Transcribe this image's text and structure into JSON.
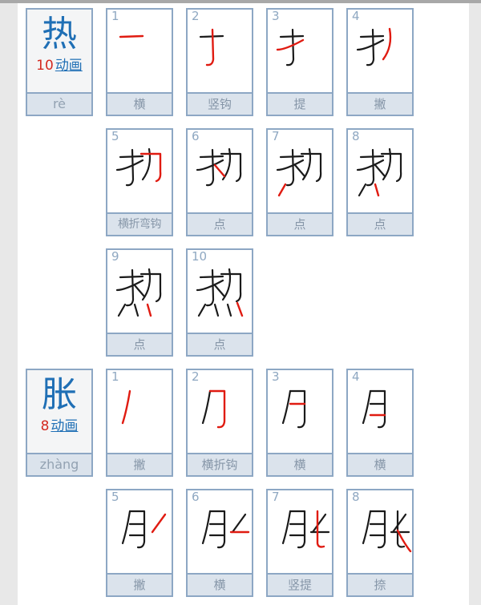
{
  "colors": {
    "page_background": "#e8e8e8",
    "content_background": "#ffffff",
    "card_border": "#8da7c4",
    "label_band": "#dbe3ec",
    "label_text": "#8696a8",
    "character_blue": "#1f6fb5",
    "count_red": "#d42a20",
    "stroke_done": "#1a1a1a",
    "stroke_active": "#e01b11"
  },
  "entries": [
    {
      "character": "热",
      "pinyin": "rè",
      "stroke_count": "10",
      "animation_label": "动画",
      "steps": [
        {
          "number": "1",
          "name": "横"
        },
        {
          "number": "2",
          "name": "竖钩"
        },
        {
          "number": "3",
          "name": "提"
        },
        {
          "number": "4",
          "name": "撇"
        },
        {
          "number": "5",
          "name": "横折弯钩"
        },
        {
          "number": "6",
          "name": "点"
        },
        {
          "number": "7",
          "name": "点"
        },
        {
          "number": "8",
          "name": "点"
        },
        {
          "number": "9",
          "name": "点"
        },
        {
          "number": "10",
          "name": "点"
        }
      ]
    },
    {
      "character": "胀",
      "pinyin": "zhàng",
      "stroke_count": "8",
      "animation_label": "动画",
      "steps": [
        {
          "number": "1",
          "name": "撇"
        },
        {
          "number": "2",
          "name": "横折钩"
        },
        {
          "number": "3",
          "name": "横"
        },
        {
          "number": "4",
          "name": "横"
        },
        {
          "number": "5",
          "name": "撇"
        },
        {
          "number": "6",
          "name": "横"
        },
        {
          "number": "7",
          "name": "竖提"
        },
        {
          "number": "8",
          "name": "捺"
        }
      ]
    }
  ]
}
